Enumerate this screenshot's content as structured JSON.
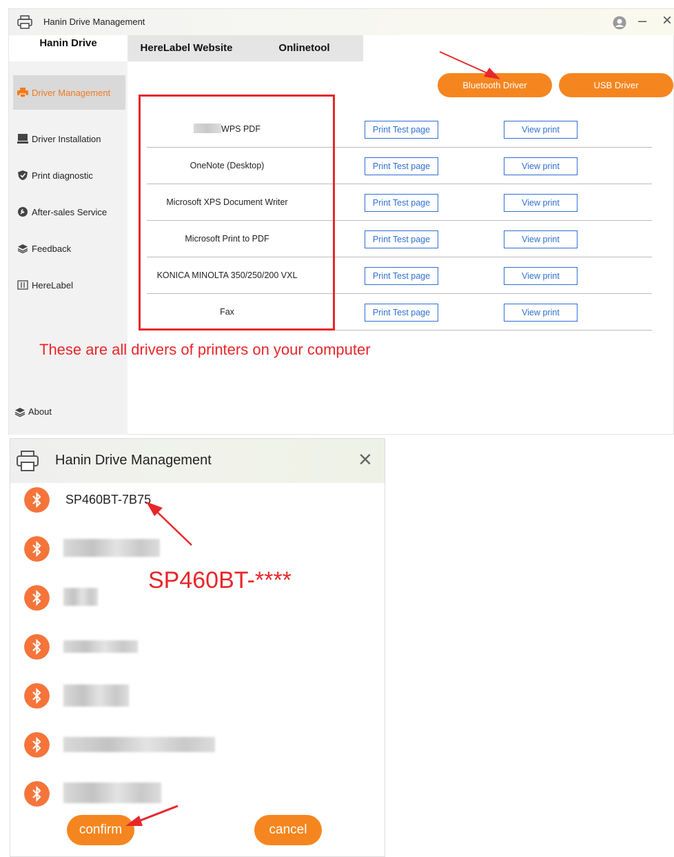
{
  "main_window": {
    "title": "Hanin Drive Management",
    "tabs": [
      {
        "label": "Hanin Drive"
      },
      {
        "label": "HereLabel Website"
      },
      {
        "label": "Onlinetool"
      }
    ],
    "sidebar": {
      "items": [
        {
          "label": "Driver Management",
          "icon": "printer-icon"
        },
        {
          "label": "Driver Installation",
          "icon": "monitor-icon"
        },
        {
          "label": "Print diagnostic",
          "icon": "shield-icon"
        },
        {
          "label": "After-sales Service",
          "icon": "wrench-icon"
        },
        {
          "label": "Feedback",
          "icon": "layers-icon"
        },
        {
          "label": "HereLabel",
          "icon": "grid-icon"
        }
      ],
      "about_label": "About"
    },
    "buttons": {
      "bluetooth": "Bluetooth Driver",
      "usb": "USB Driver"
    },
    "drivers": [
      {
        "name": "WPS PDF",
        "test_label": "Print Test page",
        "view_label": "View print"
      },
      {
        "name": "OneNote (Desktop)",
        "test_label": "Print Test page",
        "view_label": "View print"
      },
      {
        "name": "Microsoft XPS Document Writer",
        "test_label": "Print Test page",
        "view_label": "View print"
      },
      {
        "name": "Microsoft Print to PDF",
        "test_label": "Print Test page",
        "view_label": "View print"
      },
      {
        "name": "KONICA MINOLTA 350/250/200 VXL",
        "test_label": "Print Test page",
        "view_label": "View print"
      },
      {
        "name": "Fax",
        "test_label": "Print Test page",
        "view_label": "View print"
      }
    ],
    "annotation": "These are all drivers of printers on your computer"
  },
  "dialog": {
    "title": "Hanin Drive Management",
    "devices": [
      {
        "label": "SP460BT-7B75"
      }
    ],
    "hint": "SP460BT-****",
    "confirm_label": "confirm",
    "cancel_label": "cancel"
  },
  "colors": {
    "accent_orange": "#f5861f",
    "link_blue": "#2f6fd3",
    "annotation_red": "#e8262a",
    "bluetooth_orange": "#f5743a"
  }
}
